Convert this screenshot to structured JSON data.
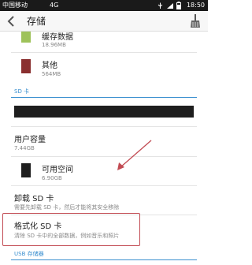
{
  "status_bar": {
    "carrier": "中国移动",
    "network": "4G",
    "time": "18:50"
  },
  "header": {
    "title": "存储",
    "back_icon": "back-chevron-icon",
    "cleanup_icon": "broom-icon"
  },
  "items": {
    "cache": {
      "label": "缓存数据",
      "size": "18.96MB",
      "color": "#9ec25a"
    },
    "other": {
      "label": "其他",
      "size": "564MB",
      "color": "#8a2f2f"
    }
  },
  "sd_section": {
    "header": "SD 卡",
    "user_capacity_label": "用户容量",
    "user_capacity_value": "7.44GB",
    "available_label": "可用空间",
    "available_value": "6.90GB",
    "available_color": "#1e1e1e",
    "unmount_label": "卸载 SD 卡",
    "unmount_desc": "需要先卸载 SD 卡，然后才能将其安全移除",
    "format_label": "格式化 SD 卡",
    "format_desc": "清除 SD 卡中的全部数据，例如音乐和照片"
  },
  "usb_section": {
    "header": "USB 存储器"
  },
  "annotation": {
    "highlight_color": "#c24b53"
  }
}
